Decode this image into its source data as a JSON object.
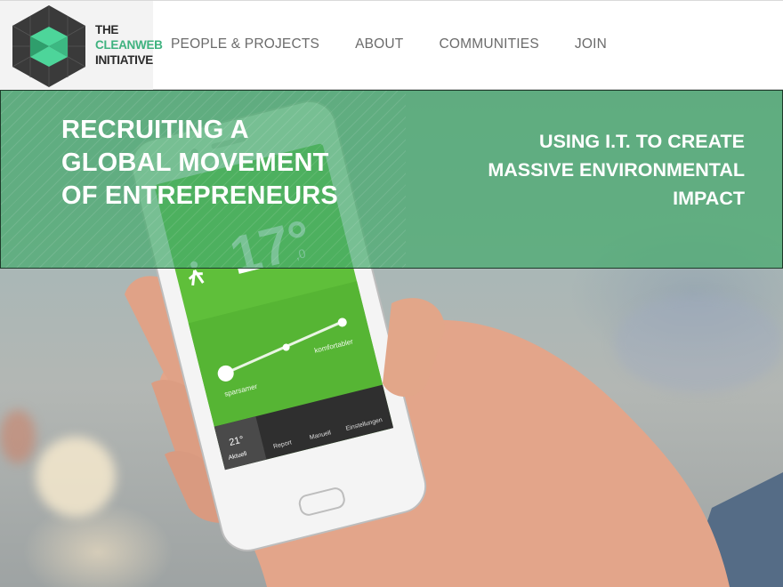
{
  "brand": {
    "line1": "THE",
    "line2": "CLEANWEB",
    "line3": "INITIATIVE",
    "accent_color": "#3fb27f"
  },
  "nav": {
    "items": [
      {
        "label": "PEOPLE & PROJECTS"
      },
      {
        "label": "ABOUT"
      },
      {
        "label": "COMMUNITIES"
      },
      {
        "label": "JOIN"
      }
    ]
  },
  "hero": {
    "headline_lines": [
      "RECRUITING A",
      "GLOBAL MOVEMENT",
      "OF ENTREPRENEURS"
    ],
    "subhead_lines": [
      "USING I.T. TO CREATE",
      "MASSIVE ENVIRONMENTAL",
      "IMPACT"
    ],
    "banner_color": "#46aa6e"
  },
  "phone": {
    "temperature": "17°",
    "temperature_decimal": ",0",
    "slider_left_label": "sparsamer",
    "slider_right_label": "komfortabler",
    "tabs": [
      {
        "label": "Aktuell",
        "value": "21°"
      },
      {
        "label": "Report"
      },
      {
        "label": "Manuell"
      },
      {
        "label": "Einstellungen"
      }
    ]
  }
}
